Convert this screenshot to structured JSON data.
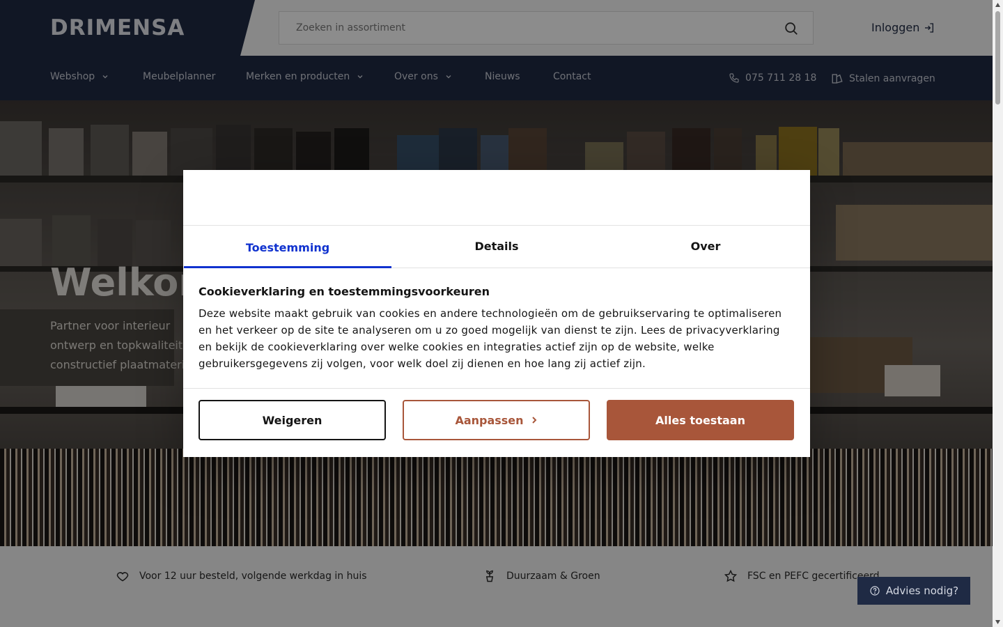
{
  "header": {
    "logo_text": "DRIMENSA",
    "search_placeholder": "Zoeken in assortiment",
    "login_label": "Inloggen"
  },
  "nav": {
    "items": [
      {
        "label": "Webshop"
      },
      {
        "label": "Meubelplanner"
      },
      {
        "label": "Merken en producten"
      },
      {
        "label": "Over ons"
      },
      {
        "label": "Nieuws"
      },
      {
        "label": "Contact"
      }
    ],
    "phone": "075 711 28 18",
    "samples_label": "Stalen aanvragen"
  },
  "hero": {
    "title": "Welkom",
    "subtitle": "Partner voor interieur ontwerp en topkwaliteit constructief plaatmateriaal"
  },
  "usp": {
    "items": [
      {
        "label": "Voor 12 uur besteld, volgende werkdag in huis",
        "icon": "heart-icon"
      },
      {
        "label": "Duurzaam & Groen",
        "icon": "plant-icon"
      },
      {
        "label": "FSC en PEFC gecertificeerd",
        "icon": "star-icon"
      }
    ]
  },
  "advies_label": "Advies nodig?",
  "cookie_modal": {
    "tabs": [
      {
        "label": "Toestemming",
        "active": true
      },
      {
        "label": "Details",
        "active": false
      },
      {
        "label": "Over",
        "active": false
      }
    ],
    "heading": "Cookieverklaring en toestemmingsvoorkeuren",
    "body": "Deze website maakt gebruik van cookies en andere technologieën om de gebruikservaring te optimaliseren en het verkeer op de site te analyseren om u zo goed mogelijk van dienst te zijn. Lees de privacyverklaring en bekijk de cookieverklaring over welke cookies en integraties actief zijn op de website, welke gebruikersgegevens zij volgen, voor welk doel zij dienen en hoe lang zij actief zijn.",
    "buttons": {
      "refuse": "Weigeren",
      "customize": "Aanpassen",
      "allow_all": "Alles toestaan"
    }
  },
  "colors": {
    "navy": "#1f2a44",
    "accent_blue": "#1032cf",
    "brand_brown": "#a8563a"
  }
}
